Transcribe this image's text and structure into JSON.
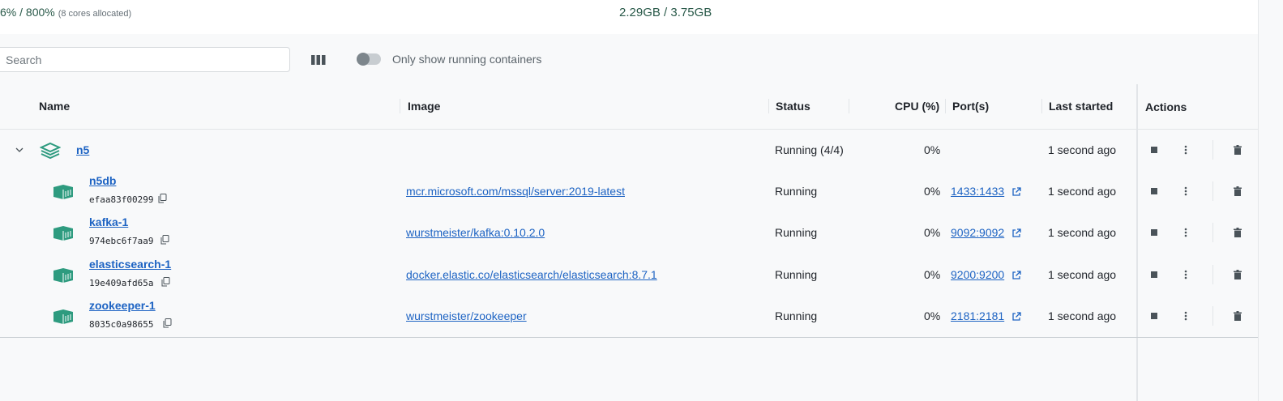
{
  "stats": {
    "cpu_main": "6% / 800%",
    "cpu_sub": "(8 cores allocated)",
    "memory": "2.29GB / 3.75GB"
  },
  "toolbar": {
    "search_placeholder": "Search",
    "toggle_label": "Only show running containers",
    "toggle_on": false
  },
  "columns": {
    "name": "Name",
    "image": "Image",
    "status": "Status",
    "cpu": "CPU (%)",
    "ports": "Port(s)",
    "last_started": "Last started",
    "actions": "Actions"
  },
  "group": {
    "name": "n5",
    "status": "Running (4/4)",
    "cpu": "0%",
    "last_started": "1 second ago"
  },
  "containers": [
    {
      "name": "n5db",
      "id": "efaa83f00299",
      "image": "mcr.microsoft.com/mssql/server:2019-latest",
      "status": "Running",
      "cpu": "0%",
      "port": "1433:1433",
      "last_started": "1 second ago"
    },
    {
      "name": "kafka-1",
      "id": "974ebc6f7aa9",
      "image": "wurstmeister/kafka:0.10.2.0",
      "status": "Running",
      "cpu": "0%",
      "port": "9092:9092",
      "last_started": "1 second ago"
    },
    {
      "name": "elasticsearch-1",
      "id": "19e409afd65a",
      "image": "docker.elastic.co/elasticsearch/elasticsearch:8.7.1",
      "status": "Running",
      "cpu": "0%",
      "port": "9200:9200",
      "last_started": "1 second ago"
    },
    {
      "name": "zookeeper-1",
      "id": "8035c0a98655",
      "image": "wurstmeister/zookeeper",
      "status": "Running",
      "cpu": "0%",
      "port": "2181:2181",
      "last_started": "1 second ago"
    }
  ],
  "colors": {
    "accent_green": "#2e9b7f",
    "link_blue": "#1d63c3"
  }
}
